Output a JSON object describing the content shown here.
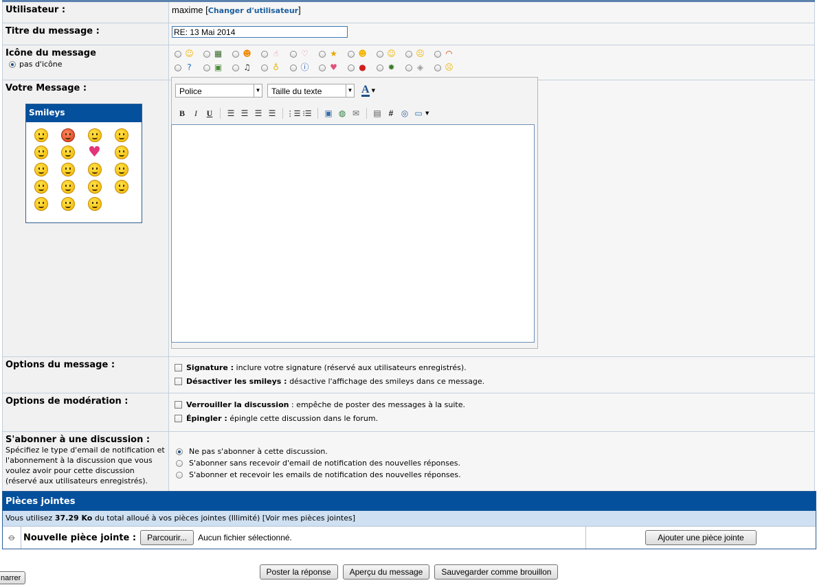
{
  "user": {
    "label": "Utilisateur :",
    "name": "maxime",
    "change_link": "Changer d'utilisateur"
  },
  "title": {
    "label": "Titre du message :",
    "value": "RE: 13 Mai 2014"
  },
  "icon": {
    "label": "Icône du message",
    "none_label": "pas d'icône",
    "row1": [
      "smiley-icon",
      "film-icon",
      "tongue-icon",
      "pointing-hand-icon",
      "speech-bubble-icon",
      "star-icon",
      "happy-icon",
      "surprised-icon",
      "sad-icon",
      "rainbow-icon"
    ],
    "row2": [
      "question-icon",
      "picture-icon",
      "music-note-icon",
      "lightbulb-icon",
      "info-icon",
      "heart-icon",
      "exclamation-icon",
      "bug-icon",
      "box-icon",
      "angry-icon"
    ]
  },
  "message": {
    "label": "Votre Message :",
    "font_select": "Police",
    "size_select": "Taille du texte"
  },
  "smileys": {
    "title": "Smileys"
  },
  "options": {
    "label": "Options du message :",
    "signature_b": "Signature :",
    "signature_t": "inclure votre signature (réservé aux utilisateurs enregistrés).",
    "smileys_b": "Désactiver les smileys :",
    "smileys_t": "désactive l'affichage des smileys dans ce message."
  },
  "moderation": {
    "label": "Options de modération :",
    "lock_b": "Verrouiller la discussion",
    "lock_t": ": empêche de poster des messages à la suite.",
    "pin_b": "Épingler :",
    "pin_t": "épingle cette discussion dans le forum."
  },
  "subscribe": {
    "label": "S'abonner à une discussion :",
    "desc": "Spécifiez le type d'email de notification et l'abonnement à la discussion que vous voulez avoir pour cette discussion (réservé aux utilisateurs enregistrés).",
    "opt1": "Ne pas s'abonner à cette discussion.",
    "opt2": "S'abonner sans recevoir d'email de notification des nouvelles réponses.",
    "opt3": "S'abonner et recevoir les emails de notification des nouvelles réponses."
  },
  "attachments": {
    "title": "Pièces jointes",
    "usage_pre": "Vous utilisez",
    "usage_amount": "37.29 Ko",
    "usage_post": "du total alloué à vos pièces jointes (Illimité) [Voir mes pièces jointes]",
    "new_label": "Nouvelle pièce jointe :",
    "browse": "Parcourir...",
    "no_file": "Aucun fichier sélectionné.",
    "add_button": "Ajouter une pièce jointe"
  },
  "buttons": {
    "post": "Poster la réponse",
    "preview": "Aperçu du message",
    "draft": "Sauvegarder comme brouillon",
    "partial": "narrer"
  }
}
